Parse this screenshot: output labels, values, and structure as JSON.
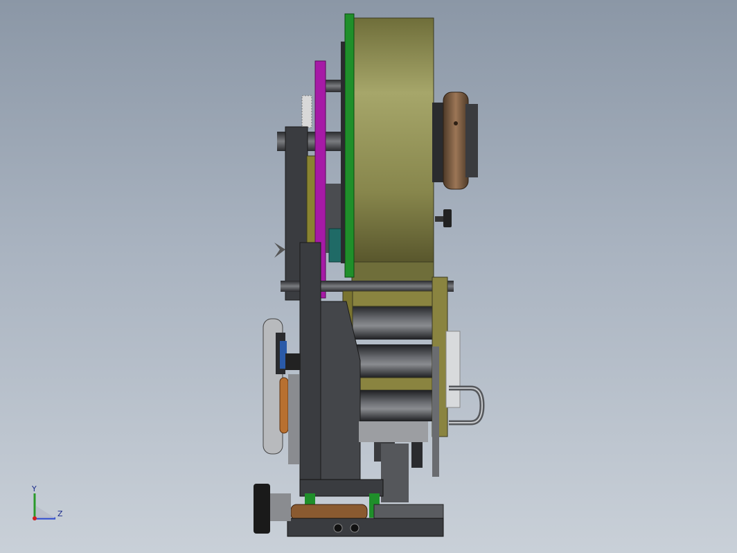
{
  "viewport": {
    "background_top": "#8b97a6",
    "background_bottom": "#c9d0d8"
  },
  "colors": {
    "drum": "#9a9a5c",
    "green_plate": "#1f8f2a",
    "magenta_plate": "#a61aa6",
    "frame": "#3c3e42",
    "bronze": "#8a6a4a",
    "olive_bracket": "#8a8440"
  },
  "triad": {
    "y_label": "Y",
    "z_label": "Z"
  }
}
